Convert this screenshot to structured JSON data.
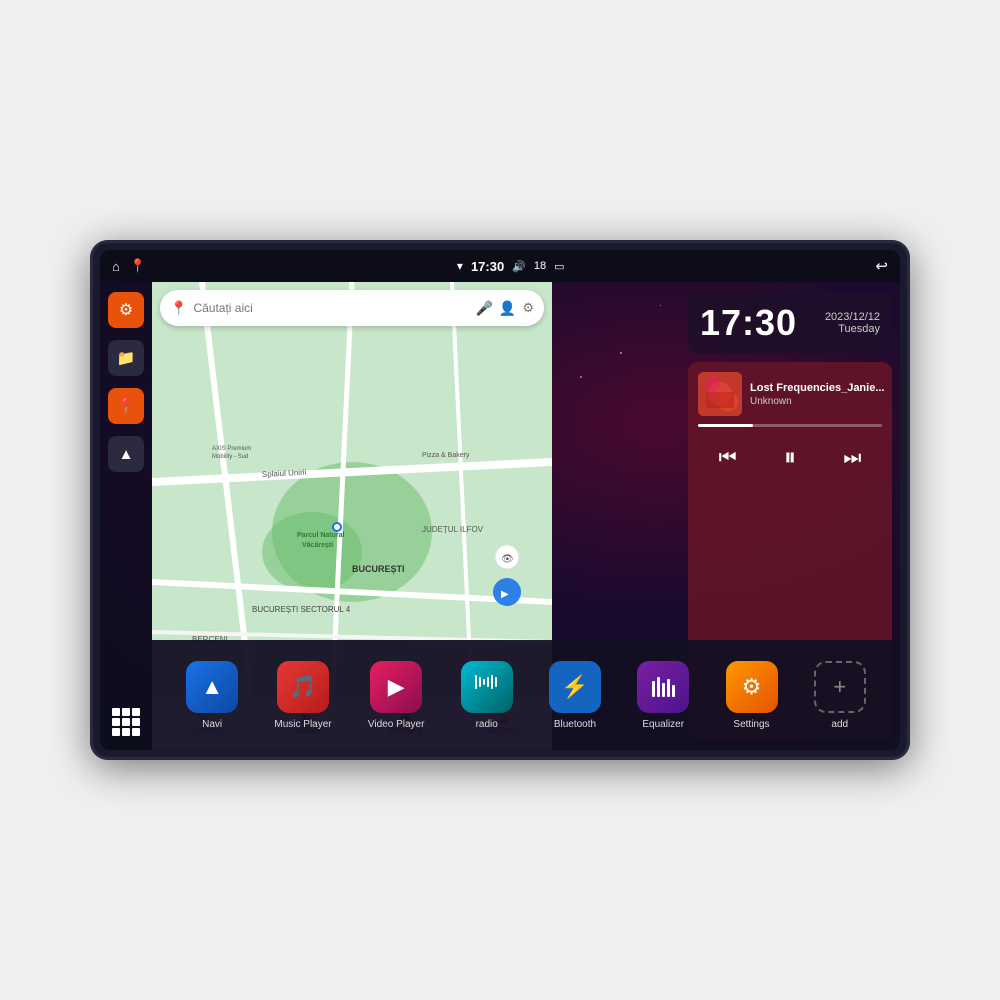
{
  "device": {
    "status_bar": {
      "wifi_icon": "▾",
      "time": "17:30",
      "volume_icon": "🔊",
      "battery_level": "18",
      "battery_icon": "🔋",
      "back_icon": "↩"
    },
    "sidebar": {
      "items": [
        {
          "name": "settings",
          "label": "Settings",
          "icon": "⚙"
        },
        {
          "name": "files",
          "label": "Files",
          "icon": "📁"
        },
        {
          "name": "maps",
          "label": "Maps",
          "icon": "📍"
        },
        {
          "name": "navigation",
          "label": "Navigation",
          "icon": "▲"
        },
        {
          "name": "apps",
          "label": "All Apps",
          "icon": "grid"
        }
      ]
    },
    "map": {
      "search_placeholder": "Căutați aici",
      "location_label": "Parcul Natural Văcărești",
      "area_label": "BUCUREȘTI",
      "area2_label": "JUDEȚUL ILFOV",
      "sector_label": "BUCUREȘTI SECTORUL 4",
      "berceni_label": "BERCENI",
      "pizza_label": "Pizza & Bakery",
      "axis_label": "AXIS Premium Mobility - Sud",
      "splai_label": "Splaiul Unirii",
      "nav_items": [
        {
          "label": "Explorați",
          "icon": "🔍",
          "active": true
        },
        {
          "label": "Salvate",
          "icon": "🔖"
        },
        {
          "label": "Trimiteți",
          "icon": "📤"
        },
        {
          "label": "Noutăți",
          "icon": "🔔"
        }
      ]
    },
    "clock": {
      "time": "17:30",
      "date": "2023/12/12",
      "day": "Tuesday"
    },
    "music": {
      "track_name": "Lost Frequencies_Janie...",
      "artist": "Unknown",
      "progress": 30
    },
    "app_dock": {
      "apps": [
        {
          "name": "Navi",
          "label": "Navi",
          "icon": "▲",
          "color": "blue-grad"
        },
        {
          "name": "Music Player",
          "label": "Music Player",
          "icon": "🎵",
          "color": "red-grad"
        },
        {
          "name": "Video Player",
          "label": "Video Player",
          "icon": "▶",
          "color": "pink-grad"
        },
        {
          "name": "radio",
          "label": "radio",
          "icon": "📻",
          "color": "teal-grad"
        },
        {
          "name": "Bluetooth",
          "label": "Bluetooth",
          "icon": "⚡",
          "color": "blue-solid"
        },
        {
          "name": "Equalizer",
          "label": "Equalizer",
          "icon": "🎚",
          "color": "purple-grad"
        },
        {
          "name": "Settings",
          "label": "Settings",
          "icon": "⚙",
          "color": "orange-grad"
        },
        {
          "name": "add",
          "label": "add",
          "icon": "+",
          "color": "outline"
        }
      ]
    }
  }
}
